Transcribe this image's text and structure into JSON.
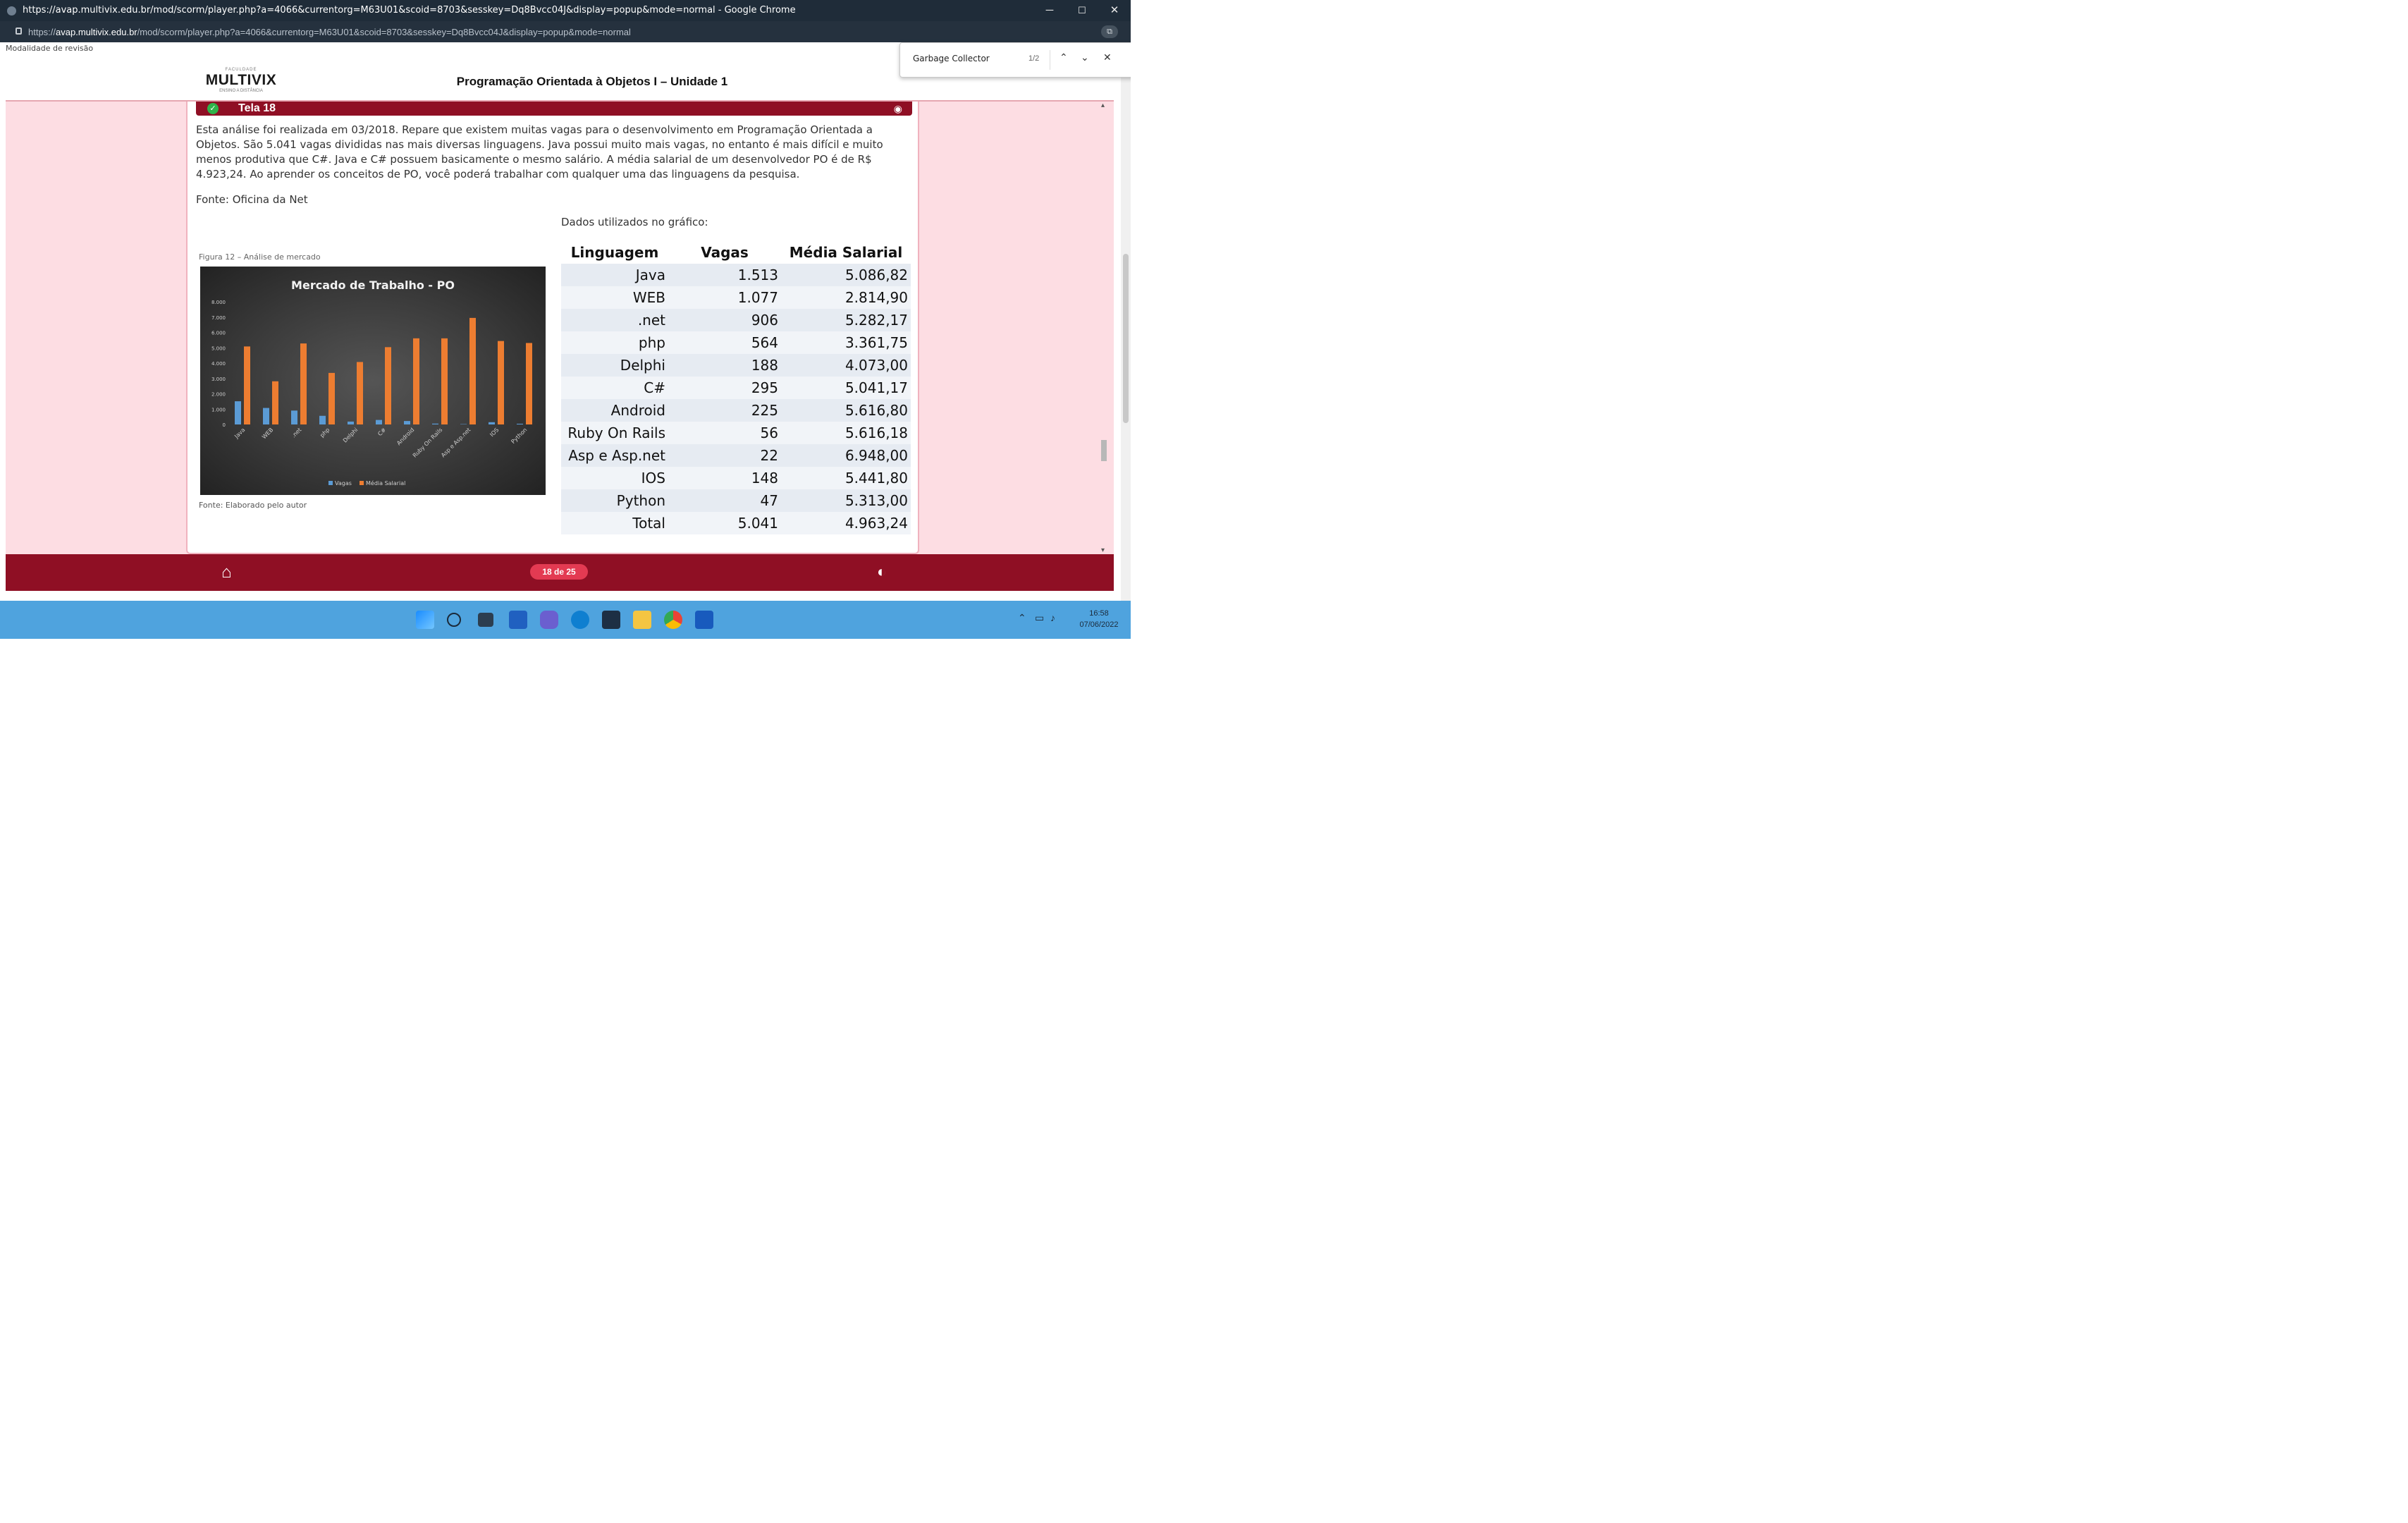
{
  "window": {
    "title": "https://avap.multivix.edu.br/mod/scorm/player.php?a=4066&currentorg=M63U01&scoid=8703&sesskey=Dq8Bvcc04J&display=popup&mode=normal - Google Chrome",
    "url_prefix": "https://",
    "url_host": "avap.multivix.edu.br",
    "url_path": "/mod/scorm/player.php?a=4066&currentorg=M63U01&scoid=8703&sesskey=Dq8Bvcc04J&display=popup&mode=normal",
    "minimize": "─",
    "maximize": "☐",
    "close": "✕"
  },
  "find": {
    "query": "Garbage Collector",
    "count": "1/2",
    "prev": "⌃",
    "next": "⌄",
    "close": "✕"
  },
  "page": {
    "mode_label": "Modalidade de revisão",
    "logo_top": "FACULDADE",
    "logo_name": "MULTIVIX",
    "logo_sub": "ENSINO A DISTÂNCIA",
    "course_title": "Programação Orientada à Objetos I – Unidade 1",
    "screen_label": "Tela 18",
    "paragraph": "Esta análise foi realizada em 03/2018. Repare que existem muitas vagas para o desenvolvimento em Programação Orientada a Objetos. São 5.041 vagas divididas nas mais diversas linguagens. Java possui muito mais vagas, no entanto é mais difícil e muito menos produtiva que C#. Java e C# possuem basicamente o mesmo salário. A média salarial de um desenvolvedor PO é de R$ 4.923,24. Ao aprender os conceitos de PO, você poderá trabalhar com qualquer uma das linguagens da pesquisa.",
    "source1": "Fonte: Oficina da Net",
    "data_label": "Dados utilizados no gráfico:",
    "figure_label": "Figura 12 – Análise de mercado",
    "source2": "Fonte: Elaborado pelo autor"
  },
  "table": {
    "headers": [
      "Linguagem",
      "Vagas",
      "Média Salarial"
    ],
    "rows": [
      [
        "Java",
        "1.513",
        "5.086,82"
      ],
      [
        "WEB",
        "1.077",
        "2.814,90"
      ],
      [
        ".net",
        "906",
        "5.282,17"
      ],
      [
        "php",
        "564",
        "3.361,75"
      ],
      [
        "Delphi",
        "188",
        "4.073,00"
      ],
      [
        "C#",
        "295",
        "5.041,17"
      ],
      [
        "Android",
        "225",
        "5.616,80"
      ],
      [
        "Ruby On Rails",
        "56",
        "5.616,18"
      ],
      [
        "Asp e Asp.net",
        "22",
        "6.948,00"
      ],
      [
        "IOS",
        "148",
        "5.441,80"
      ],
      [
        "Python",
        "47",
        "5.313,00"
      ],
      [
        "Total",
        "5.041",
        "4.963,24"
      ]
    ]
  },
  "chart_data": {
    "type": "bar",
    "title": "Mercado de Trabalho - PO",
    "categories": [
      "Java",
      "WEB",
      ".net",
      "php",
      "Delphi",
      "C#",
      "Android",
      "Ruby On Rails",
      "Asp e Asp.net",
      "IOS",
      "Python"
    ],
    "series": [
      {
        "name": "Vagas",
        "color": "#5b9bd5",
        "values": [
          1513,
          1077,
          906,
          564,
          188,
          295,
          225,
          56,
          22,
          148,
          47
        ]
      },
      {
        "name": "Média Salarial",
        "color": "#ed7d31",
        "values": [
          5086.82,
          2814.9,
          5282.17,
          3361.75,
          4073.0,
          5041.17,
          5616.8,
          5616.18,
          6948.0,
          5441.8,
          5313.0
        ]
      }
    ],
    "ylim": [
      0,
      8000
    ],
    "yticks": [
      "0",
      "1.000",
      "2.000",
      "3.000",
      "4.000",
      "5.000",
      "6.000",
      "7.000",
      "8.000"
    ],
    "legend": "bottom",
    "grid": false
  },
  "footer": {
    "home_icon": "⌂",
    "pager": "18 de 25",
    "contrast_icon": "◐"
  },
  "taskbar": {
    "time": "16:58",
    "date": "07/06/2022",
    "icons": [
      "windows-start",
      "search",
      "task-view",
      "widgets",
      "teams-chat",
      "edge",
      "store",
      "file-explorer",
      "chrome",
      "word"
    ]
  },
  "colors": {
    "accent": "#8f0f24",
    "panel_bg": "#fddde3",
    "taskbar": "#4fa3de"
  }
}
